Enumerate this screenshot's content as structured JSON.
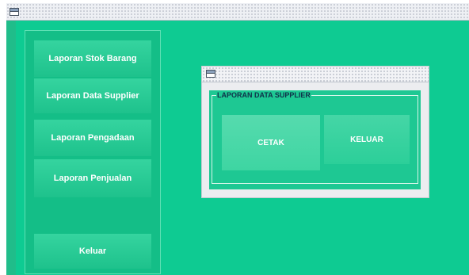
{
  "main_window": {
    "title": "",
    "icon": "window-icon"
  },
  "sidebar": {
    "items": [
      {
        "label": "Laporan Stok Barang"
      },
      {
        "label": "Laporan Data Supplier"
      },
      {
        "label": "Laporan  Pengadaan"
      },
      {
        "label": "Laporan Penjualan"
      }
    ],
    "exit_label": "Keluar"
  },
  "dialog": {
    "title": "",
    "icon": "window-icon",
    "group_title": "LAPORAN DATA SUPPLIER",
    "print_label": "CETAK",
    "exit_label": "KELUAR"
  },
  "colors": {
    "background": "#0ecb92",
    "panel": "#14be87",
    "button": "#2ccf99",
    "button_text": "#ffffff",
    "dialog_bg": "#ecedf0"
  }
}
